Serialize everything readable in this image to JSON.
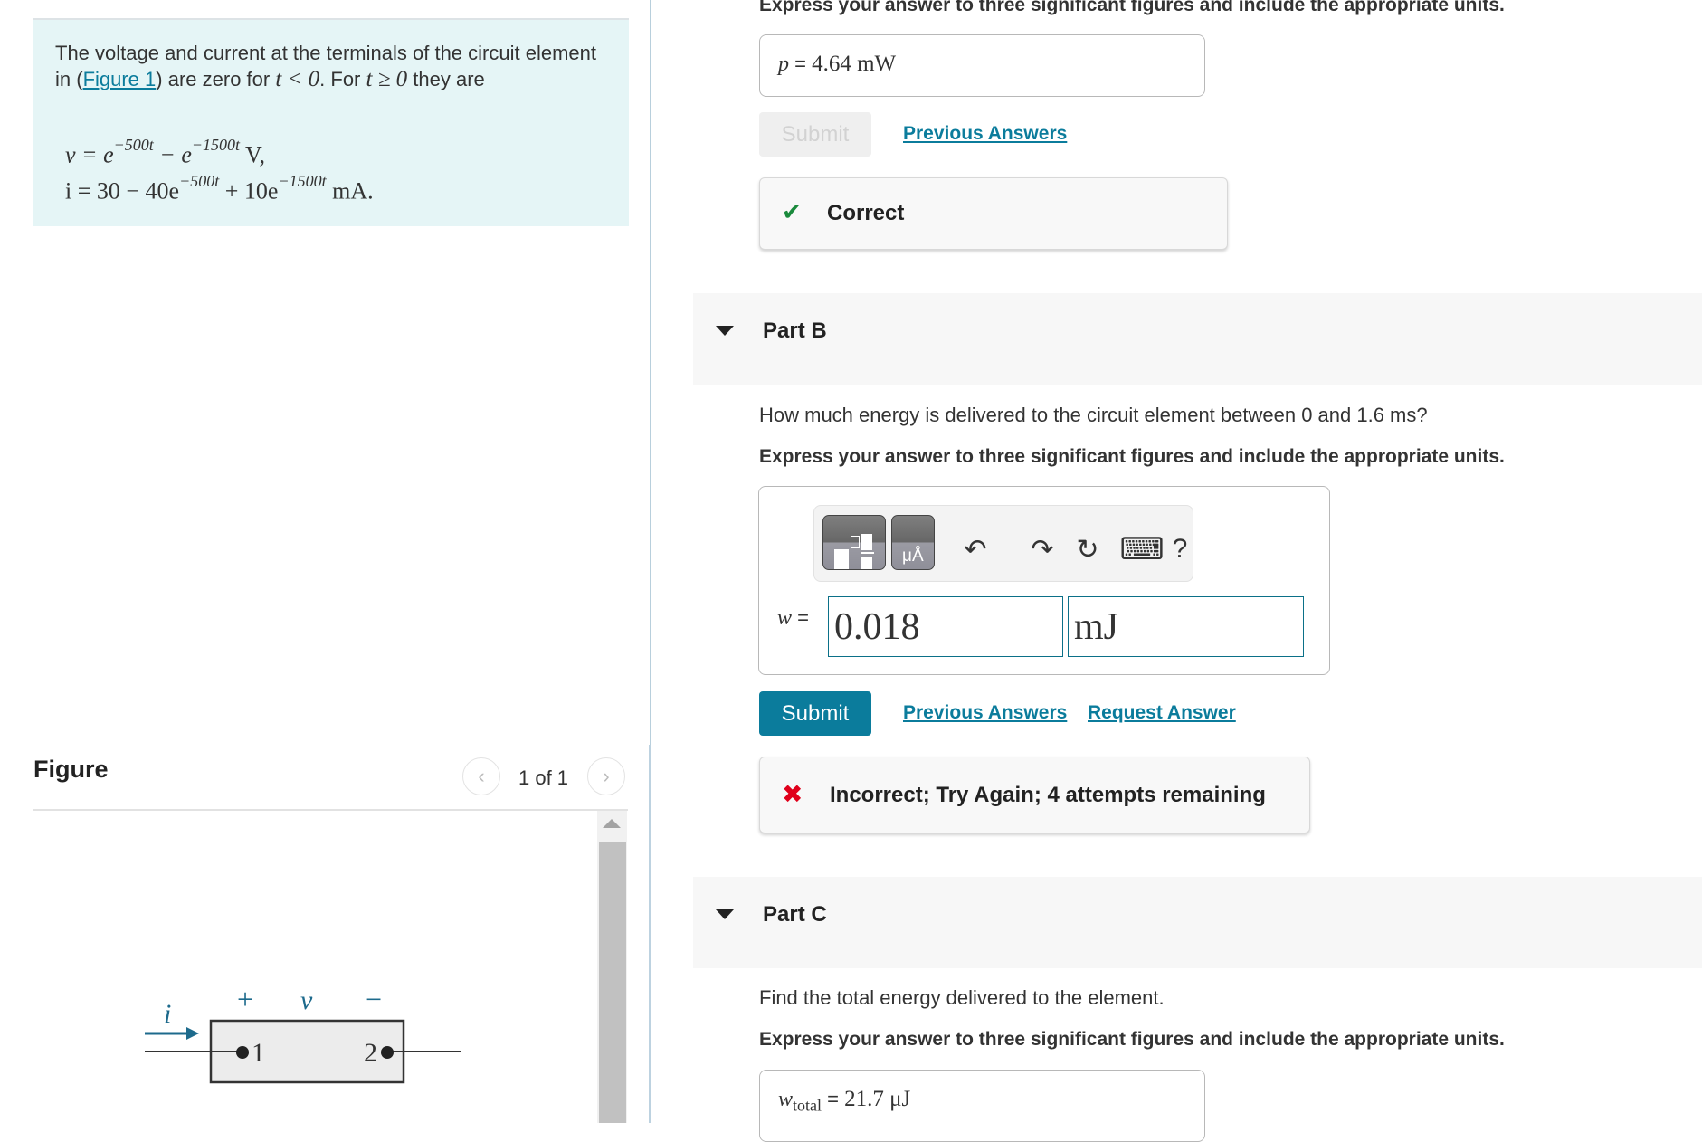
{
  "problem": {
    "intro_before_link": "The voltage and current at the terminals of the circuit element in (",
    "figure_link": "Figure 1",
    "intro_after_link": ") are zero for ",
    "cond1": "t < 0",
    "intro_mid": ". For ",
    "cond2": "t ≥ 0",
    "intro_end": " they are",
    "equations": {
      "v_lhs": "v = e",
      "v_exp1": "−500t",
      "v_mid": " − e",
      "v_exp2": "−1500t",
      "v_unit": " V,",
      "i_lhs": "i = 30 − 40e",
      "i_exp1": "−500t",
      "i_mid": " + 10e",
      "i_exp2": "−1500t",
      "i_unit": " mA."
    }
  },
  "figure": {
    "title": "Figure",
    "counter": "1 of 1",
    "prev_icon": "‹",
    "next_icon": "›",
    "circuit": {
      "current_label": "i",
      "plus": "+",
      "voltage_label": "v",
      "minus": "−",
      "terminal1": "1",
      "terminal2": "2"
    }
  },
  "part_a": {
    "instruction": "Express your answer to three significant figures and include the appropriate units.",
    "answer_var": "p",
    "answer_eq": " = ",
    "answer_value": "4.64 mW",
    "submit_label": "Submit",
    "previous_answers": "Previous Answers",
    "feedback": "Correct",
    "feedback_icon": "✔",
    "feedback_color": "#1a8a3c"
  },
  "part_b": {
    "title": "Part B",
    "question": "How much energy is delivered to the circuit element between 0 and 1.6 ms?",
    "instruction": "Express your answer to three significant figures and include the appropriate units.",
    "answer_var": "w",
    "answer_eq": " = ",
    "value_input": "0.018",
    "unit_input": "mJ",
    "toolbar": {
      "undo_icon": "↶",
      "redo_icon": "↷",
      "reset_icon": "↻",
      "keyboard_icon": "⌨",
      "help_icon": "?"
    },
    "submit_label": "Submit",
    "previous_answers": "Previous Answers",
    "request_answer": "Request Answer",
    "feedback": "Incorrect; Try Again; 4 attempts remaining",
    "feedback_icon": "✖",
    "feedback_color": "#e0001b"
  },
  "part_c": {
    "title": "Part C",
    "question": "Find the total energy delivered to the element.",
    "instruction": "Express your answer to three significant figures and include the appropriate units.",
    "answer_var": "w",
    "answer_sub": "total",
    "answer_eq": " = ",
    "answer_value": "21.7 μJ"
  },
  "colors": {
    "accent": "#0b7c9c",
    "problem_bg": "#e5f5f6",
    "part_band": "#f7f7f7"
  }
}
